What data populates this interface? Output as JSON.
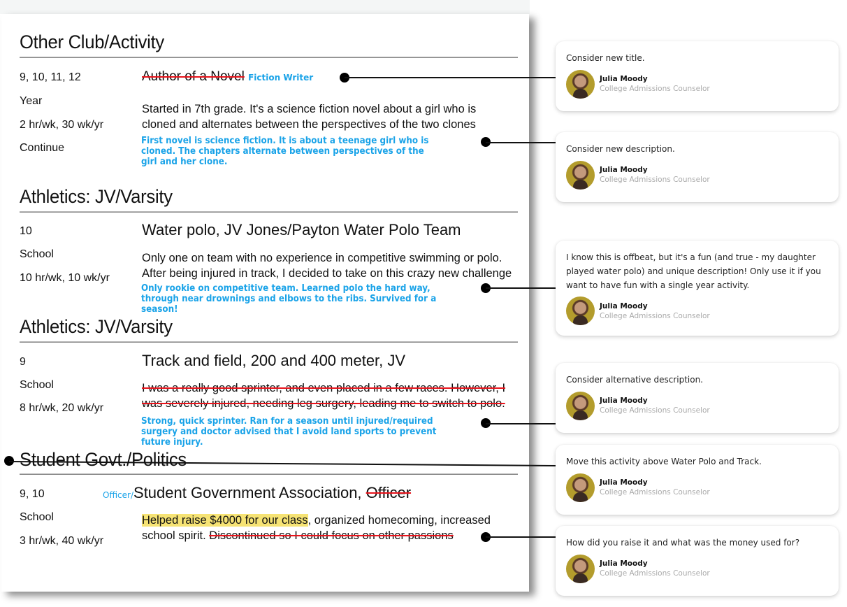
{
  "sections": [
    {
      "heading": "Other Club/Activity",
      "meta": [
        "9, 10, 11, 12",
        "Year",
        "2 hr/wk, 30 wk/yr",
        "Continue"
      ],
      "title_struck": "Author of a Novel",
      "title_suggestion": "Fiction Writer",
      "desc_lines": [
        "Started in 7th grade. It's a science fiction novel about a girl who is",
        "cloned and alternates between the perspectives of the two clones"
      ],
      "suggestion_lines": [
        "First novel is science fiction. It is about a teenage girl who is",
        "cloned. The chapters alternate between perspectives of the",
        "girl and her clone."
      ]
    },
    {
      "heading": "Athletics: JV/Varsity",
      "meta": [
        "10",
        "School",
        "10 hr/wk, 10 wk/yr"
      ],
      "title": "Water polo, JV Jones/Payton Water Polo Team",
      "desc_lines": [
        "Only one on team with no experience in competitive swimming or polo.",
        "After being injured in track, I decided to take on this crazy new challenge"
      ],
      "suggestion_lines": [
        "Only rookie on competitive team. Learned polo the hard way,",
        "through near drownings and elbows to the ribs. Survived for a",
        "season!"
      ]
    },
    {
      "heading": "Athletics: JV/Varsity",
      "meta": [
        "9",
        "School",
        "8 hr/wk, 20 wk/yr"
      ],
      "title": "Track and field, 200 and 400 meter, JV",
      "desc_struck_lines": [
        "I was a really good sprinter, and even placed in a few races. However, I",
        "was severely injured, needing leg surgery, leading me to switch to polo."
      ],
      "suggestion_lines": [
        "Strong, quick sprinter. Ran for a season until injured/required",
        "surgery and doctor advised that I avoid land sports to prevent",
        "future injury."
      ]
    },
    {
      "heading": "Student Govt./Politics",
      "meta": [
        "9, 10",
        "School",
        "3 hr/wk, 40 wk/yr"
      ],
      "title_prefix_suggestion": "Officer/",
      "title": "Student Government Association,",
      "title_struck": "Officer",
      "desc_highlight": "Helped raise $4000 for our class",
      "desc_rest": ", organized homecoming, increased",
      "desc_line2": "school spirit.",
      "desc_struck": "Discontinued so I could focus on other passions"
    }
  ],
  "comments": [
    {
      "text": "Consider new title.",
      "author": "Julia Moody",
      "role": "College Admissions Counselor"
    },
    {
      "text": "Consider new description.",
      "author": "Julia Moody",
      "role": "College Admissions Counselor"
    },
    {
      "text": "I know this is offbeat, but it's a fun (and true - my daughter played water polo) and unique description! Only use it if you want to have fun with a single year activity.",
      "author": "Julia Moody",
      "role": "College Admissions Counselor"
    },
    {
      "text": "Consider alternative description.",
      "author": "Julia Moody",
      "role": "College Admissions Counselor"
    },
    {
      "text": "Move this activity above Water Polo and Track.",
      "author": "Julia Moody",
      "role": "College Admissions Counselor"
    },
    {
      "text": "How did you raise it and what was the money used for?",
      "author": "Julia Moody",
      "role": "College Admissions Counselor"
    }
  ],
  "colors": {
    "suggestion": "#1aa3e8",
    "strike": "#e8141c",
    "highlight": "#f6e374"
  }
}
